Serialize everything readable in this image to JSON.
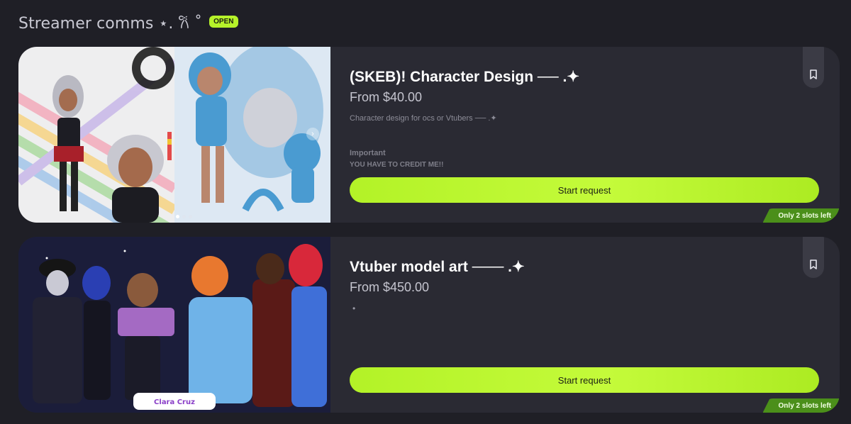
{
  "section": {
    "title": "Streamer comms ⋆. 𐙚 ˚",
    "badge": "OPEN"
  },
  "listings": [
    {
      "title": "(SKEB)! Character Design ── .✦",
      "price": "From $40.00",
      "description": "Character design for ocs or Vtubers ── .✦",
      "important_label": "Important",
      "important_text": "YOU HAVE TO CREDIT ME!!",
      "button_label": "Start request",
      "slots": "Only 2 slots left",
      "icon": "bookmark-icon"
    },
    {
      "title": "Vtuber model art ─── .✦",
      "price": "From $450.00",
      "description": "•",
      "button_label": "Start request",
      "slots": "Only 2 slots left",
      "icon": "bookmark-icon",
      "image_caption": "Clara Cruz"
    }
  ],
  "colors": {
    "background": "#1f1f26",
    "card": "#2a2a33",
    "accent": "#b6f22a",
    "slots_badge": "#4b8f1a"
  }
}
